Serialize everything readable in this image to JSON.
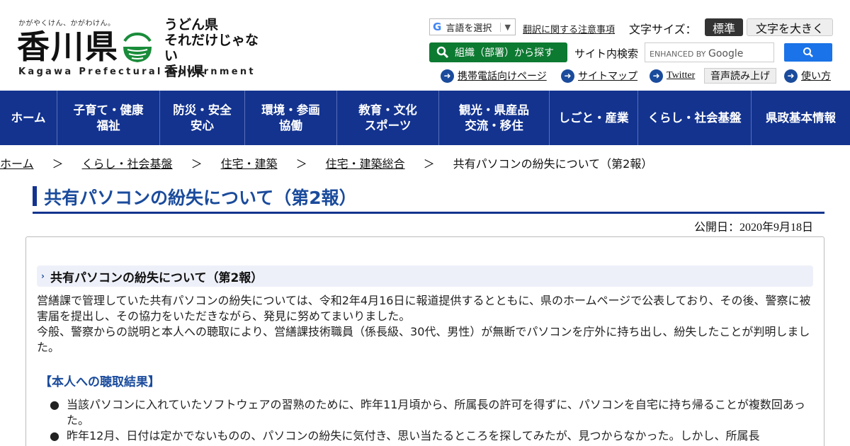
{
  "logo": {
    "tagline": "かがやくけん、かがわけん。",
    "kanji": "香川県",
    "catch_line1": "うどん県",
    "catch_line2": "それだけじゃない",
    "catch_line3": "香川県",
    "english": "Kagawa Prefectural Government"
  },
  "header": {
    "translate_label": "言語を選択",
    "translate_arrow": "▼",
    "translate_note": "翻訳に関する注意事項",
    "fontsize_label": "文字サイズ：",
    "fontsize_standard": "標準",
    "fontsize_large": "文字を大きく",
    "org_search": "組織（部署）から探す",
    "site_search_label": "サイト内検索",
    "search_enhanced": "ENHANCED BY",
    "search_google": "Google",
    "links": {
      "mobile": "携帯電話向けページ",
      "sitemap": "サイトマップ",
      "twitter": "Twitter",
      "read_aloud": "音声読み上げ",
      "usage": "使い方"
    }
  },
  "nav": [
    {
      "label": "ホーム"
    },
    {
      "label": "子育て・健康\n福祉"
    },
    {
      "label": "防災・安全\n安心"
    },
    {
      "label": "環境・参画\n協働"
    },
    {
      "label": "教育・文化\nスポーツ"
    },
    {
      "label": "観光・県産品\n交流・移住"
    },
    {
      "label": "しごと・産業"
    },
    {
      "label": "くらし・社会基盤"
    },
    {
      "label": "県政基本情報"
    }
  ],
  "breadcrumb": {
    "items": [
      "ホーム",
      "くらし・社会基盤",
      "住宅・建築",
      "住宅・建築総合"
    ],
    "current": "共有パソコンの紛失について（第2報）",
    "separator": "＞"
  },
  "page": {
    "title": "共有パソコンの紛失について（第2報）",
    "publish_date": "公開日：2020年9月18日",
    "section_heading": "共有パソコンの紛失について（第2報）",
    "para1": "営繕課で管理していた共有パソコンの紛失については、令和2年4月16日に報道提供するとともに、県のホームページで公表しており、その後、警察に被害届を提出し、その協力をいただきながら、発見に努めてまいりました。",
    "para2": "今般、警察からの説明と本人への聴取により、営繕課技術職員（係長級、30代、男性）が無断でパソコンを庁外に持ち出し、紛失したことが判明しました。",
    "subhead": "【本人への聴取結果】",
    "bullets": [
      "当該パソコンに入れていたソフトウェアの習熟のために、昨年11月頃から、所属長の許可を得ずに、パソコンを自宅に持ち帰ることが複数回あった。",
      "昨年12月、日付は定かでないものの、パソコンの紛失に気付き、思い当たるところを探してみたが、見つからなかった。しかし、所属長"
    ],
    "bullet_mark": "●"
  },
  "colors": {
    "nav_bg": "#13338f",
    "title_text": "#1a4b9c",
    "org_button": "#0d7a32",
    "search_button": "#1a73e8"
  }
}
